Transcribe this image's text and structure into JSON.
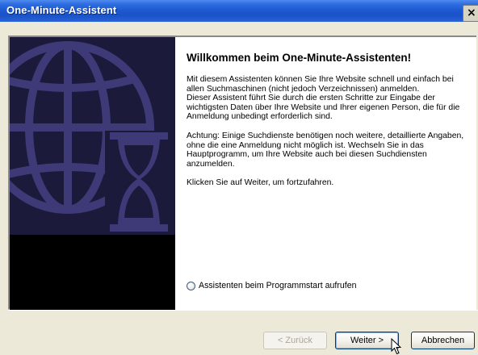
{
  "window": {
    "title": "One-Minute-Assistent",
    "close_label": "×"
  },
  "content": {
    "heading": "Willkommen beim One-Minute-Assistenten!",
    "paragraphs": [
      "Mit diesem Assistenten können Sie Ihre Website schnell und einfach bei allen Suchmaschinen (nicht jedoch Verzeichnissen) anmelden.",
      "Dieser Assistent führt Sie durch die ersten Schritte zur Eingabe der wichtigsten Daten über Ihre Website und Ihrer eigenen Person, die für die Anmeldung unbedingt erforderlich sind.",
      "Achtung: Einige Suchdienste benötigen noch weitere, detaillierte Angaben, ohne die eine Anmeldung nicht möglich ist. Wechseln Sie in das Hauptprogramm, um Ihre Website auch bei diesen Suchdiensten anzumelden.",
      "Klicken Sie auf Weiter, um fortzufahren."
    ],
    "radio_label": "Assistenten beim Programmstart aufrufen",
    "radio_checked": false
  },
  "side_image": {
    "icon": "globe-hourglass-icon",
    "colors": {
      "background": "#1c1a3a",
      "shape": "#3e3a78"
    }
  },
  "buttons": {
    "back_label": "< Zurück",
    "next_label": "Weiter >",
    "cancel_label": "Abbrechen"
  },
  "colors": {
    "titlebar": "#1a52c8",
    "dialog_bg": "#ece9d8",
    "panel_bg": "#ffffff"
  }
}
